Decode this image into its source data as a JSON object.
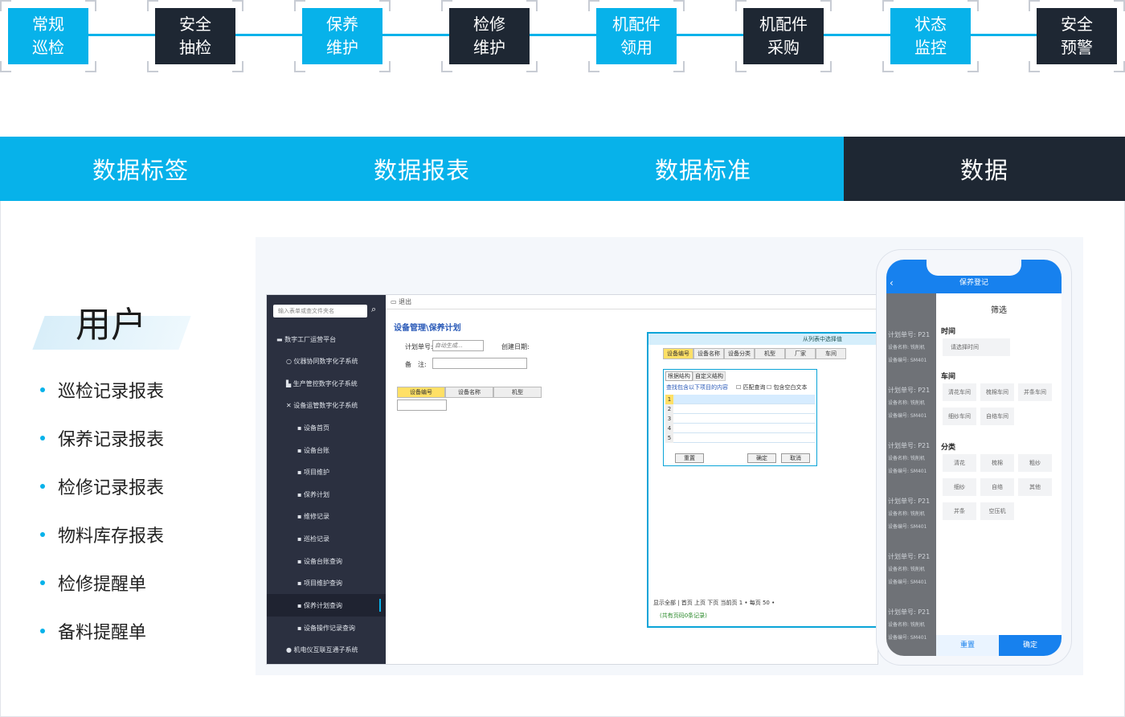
{
  "flow": [
    {
      "label": "常规\n巡检",
      "style": "blue"
    },
    {
      "label": "安全\n抽检",
      "style": "dark"
    },
    {
      "label": "保养\n维护",
      "style": "blue"
    },
    {
      "label": "检修\n维护",
      "style": "dark"
    },
    {
      "label": "机配件\n领用",
      "style": "blue"
    },
    {
      "label": "机配件\n采购",
      "style": "dark"
    },
    {
      "label": "状态\n监控",
      "style": "blue"
    },
    {
      "label": "安全\n预警",
      "style": "dark"
    }
  ],
  "tabs": [
    "数据标签",
    "数据报表",
    "数据标准",
    "数据"
  ],
  "colors": {
    "accent": "#07b2ea",
    "dark": "#1e2733"
  },
  "user": {
    "title": "用户",
    "features": [
      "巡检记录报表",
      "保养记录报表",
      "检修记录报表",
      "物料库存报表",
      "检修提醒单",
      "备料提醒单"
    ]
  },
  "desktop": {
    "search_placeholder": "输入表单或查文件夹名",
    "sidebar": [
      "数字工厂运营平台",
      "仪器协同数字化子系统",
      "生产管控数字化子系统",
      "设备运管数字化子系统",
      "设备首页",
      "设备台账",
      "项目维护",
      "保养计划",
      "维修记录",
      "巡检记录",
      "设备台账查询",
      "项目维护查询",
      "保养计划查询",
      "设备操作记录查询",
      "机电仪互联互通子系统"
    ],
    "topbar": "退出",
    "page_title": "设备管理\\保养计划",
    "fields": {
      "plan_no": "计划单号:",
      "plan_no_value": "自动生成...",
      "created": "创建日期:",
      "remark": "备　注:"
    },
    "grid_headers": [
      "设备编号",
      "设备名称",
      "机型"
    ],
    "dialog": {
      "title": "从列表中选择值",
      "headers": [
        "设备编号",
        "设备名称",
        "设备分类",
        "机型",
        "厂家",
        "车间"
      ],
      "sub_tabs": [
        "根据结构",
        "自定义结构"
      ],
      "sub_hint": "查找包含以下项目的内容",
      "check1": "匹配查询",
      "check2": "包含空白文本",
      "rows": [
        "1",
        "2",
        "3",
        "4",
        "5"
      ],
      "sub_buttons": [
        "重置",
        "确定",
        "取消"
      ],
      "pager": "显示全部 | 首页  上页  下页  当前页 1  • 每页 50  •",
      "count": "(共有页码0条记录)",
      "buttons": [
        "确定",
        "取消"
      ]
    }
  },
  "mobile": {
    "title": "保养登记",
    "left_rows": [
      "计划单号: P21",
      "设备名称: 铣削机",
      "设备编号: SM401"
    ],
    "filter_title": "筛选",
    "time_label": "时间",
    "time_placeholder": "请选择时间",
    "workshop_label": "车间",
    "workshops": [
      "清花车间",
      "梳棉车间",
      "并条车间",
      "细纱车间",
      "自络车间"
    ],
    "category_label": "分类",
    "categories": [
      "清花",
      "梳棉",
      "粗纱",
      "细纱",
      "自络",
      "其他",
      "并条",
      "空压机"
    ],
    "reset": "重置",
    "confirm": "确定"
  }
}
